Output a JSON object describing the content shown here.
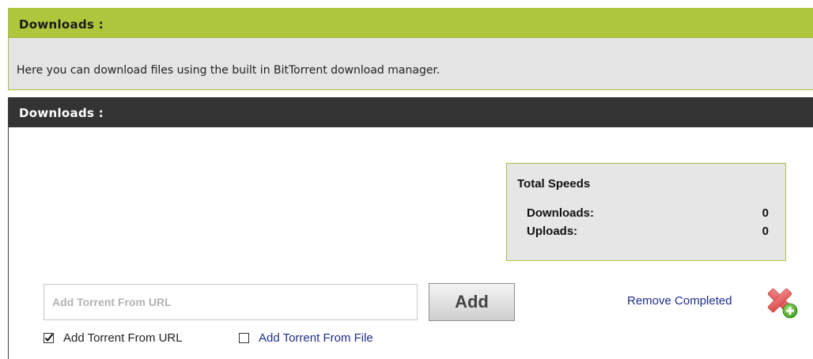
{
  "info_panel": {
    "title": "Downloads :",
    "description": "Here you can download files using the built in BitTorrent download manager."
  },
  "downloads_panel": {
    "title": "Downloads :"
  },
  "total_speeds": {
    "title": "Total Speeds",
    "downloads_label": "Downloads:",
    "downloads_value": "0",
    "uploads_label": "Uploads:",
    "uploads_value": "0"
  },
  "add_form": {
    "url_placeholder": "Add Torrent From URL",
    "url_value": "",
    "add_button": "Add",
    "remove_completed": "Remove Completed",
    "remove_icon": "remove-completed-icon"
  },
  "source_options": [
    {
      "label": "Add Torrent From URL",
      "checked": true
    },
    {
      "label": "Add Torrent From File",
      "checked": false
    }
  ],
  "colors": {
    "accent_green": "#aec63b",
    "dark_header": "#333333",
    "link_blue": "#1f2e8a",
    "icon_red": "#e35a5a",
    "icon_green": "#55b12f"
  }
}
